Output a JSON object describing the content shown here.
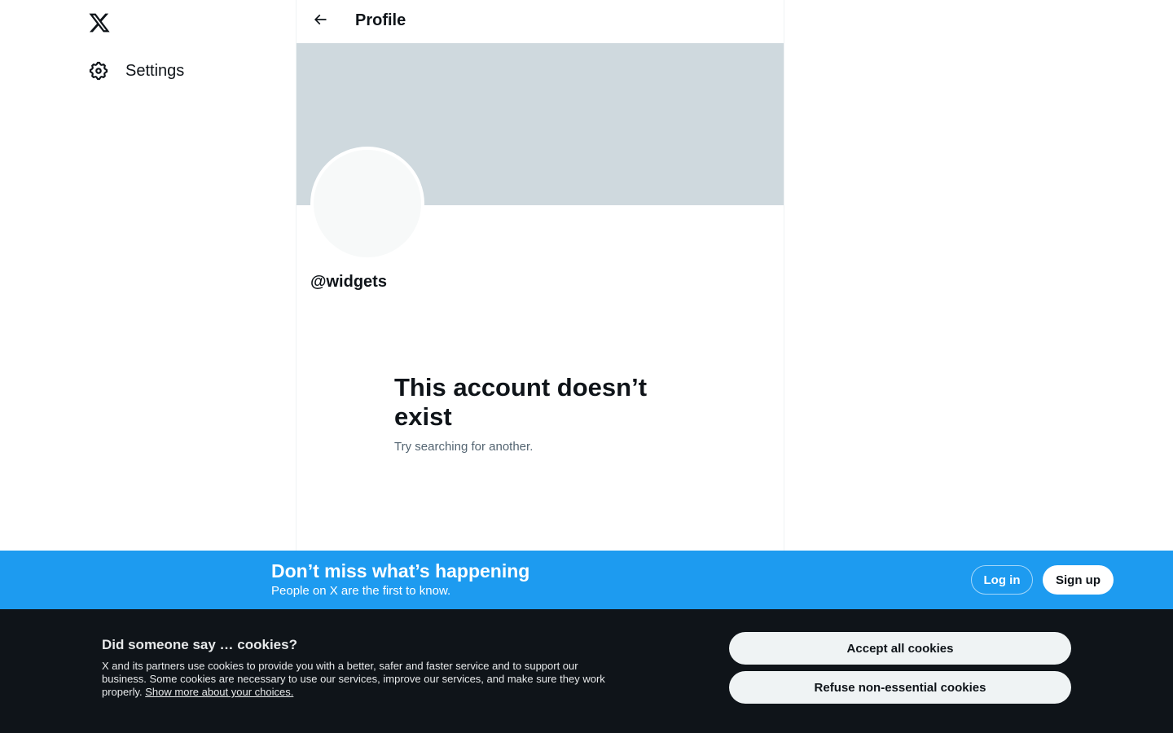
{
  "nav": {
    "logo_icon": "x-logo-icon",
    "settings_label": "Settings",
    "settings_icon": "gear-icon"
  },
  "header": {
    "back_icon": "arrow-left-icon",
    "title": "Profile"
  },
  "profile": {
    "handle": "@widgets",
    "empty_title": "This account doesn’t exist",
    "empty_subtitle": "Try searching for another."
  },
  "signup_bar": {
    "title": "Don’t miss what’s happening",
    "subtitle": "People on X are the first to know.",
    "login_label": "Log in",
    "signup_label": "Sign up"
  },
  "cookies": {
    "title": "Did someone say … cookies?",
    "text": "X and its partners use cookies to provide you with a better, safer and faster service and to support our business. Some cookies are necessary to use our services, improve our services, and make sure they work properly.",
    "link_label": "Show more about your choices.",
    "accept_label": "Accept all cookies",
    "refuse_label": "Refuse non-essential cookies"
  },
  "colors": {
    "accent": "#1d9bf0",
    "banner": "#cfd9de",
    "cookie_bg": "#0f1419",
    "text_secondary": "#536471"
  }
}
